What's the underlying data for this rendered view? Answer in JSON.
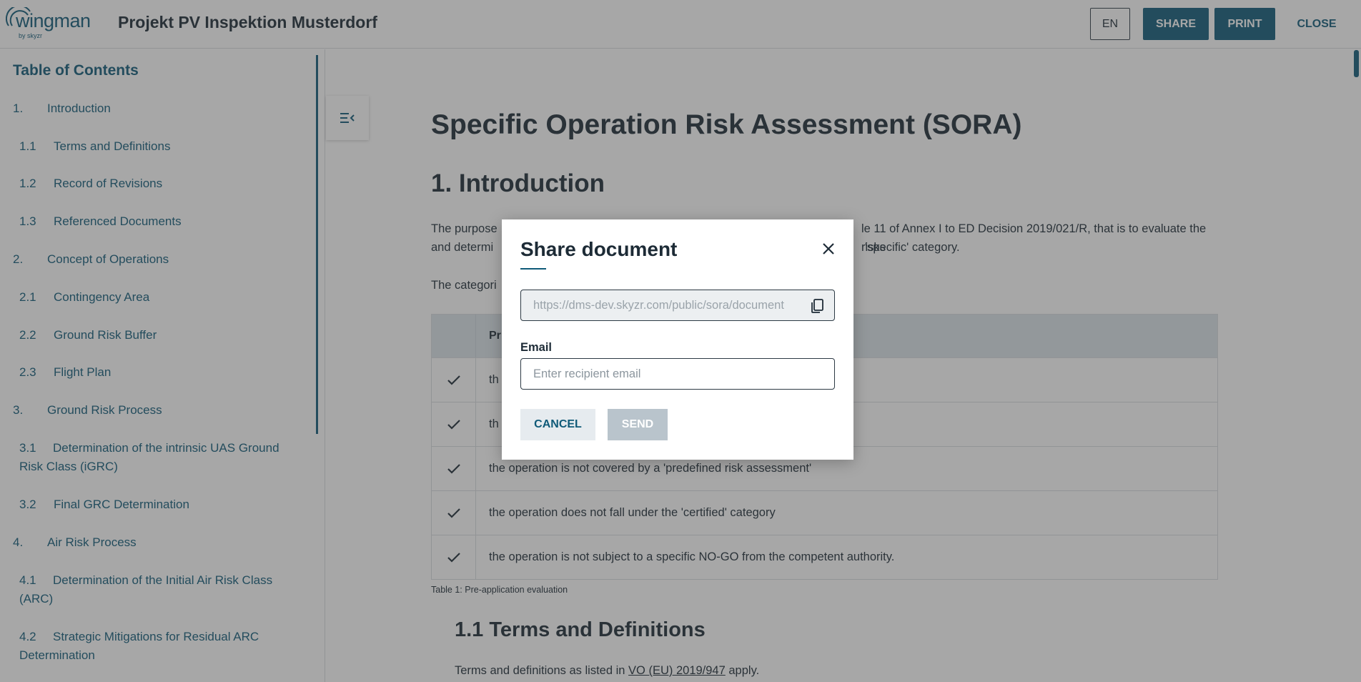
{
  "header": {
    "logo_text": "wingman",
    "logo_sub": "by skyzr",
    "project_title": "Projekt PV Inspektion Musterdorf",
    "lang_button": "EN",
    "share_button": "SHARE",
    "print_button": "PRINT",
    "close_button": "CLOSE",
    "accent_color": "#0f5a78"
  },
  "sidebar": {
    "title": "Table of Contents",
    "items": [
      {
        "num": "1.",
        "label": "Introduction"
      },
      {
        "num": "1.1",
        "label": "Terms and Definitions"
      },
      {
        "num": "1.2",
        "label": "Record of Revisions"
      },
      {
        "num": "1.3",
        "label": "Referenced Documents"
      },
      {
        "num": "2.",
        "label": "Concept of Operations"
      },
      {
        "num": "2.1",
        "label": "Contingency Area"
      },
      {
        "num": "2.2",
        "label": "Ground Risk Buffer"
      },
      {
        "num": "2.3",
        "label": "Flight Plan"
      },
      {
        "num": "3.",
        "label": "Ground Risk Process"
      },
      {
        "num": "3.1",
        "label": "Determination of the intrinsic UAS Ground Risk Class (iGRC)"
      },
      {
        "num": "3.2",
        "label": "Final GRC Determination"
      },
      {
        "num": "4.",
        "label": "Air Risk Process"
      },
      {
        "num": "4.1",
        "label": "Determination of the Initial Air Risk Class (ARC)"
      },
      {
        "num": "4.2",
        "label": "Strategic Mitigations for Residual ARC Determination"
      }
    ]
  },
  "document": {
    "title": "Specific Operation Risk Assessment (SORA)",
    "section1_heading": "1. Introduction",
    "intro_line1_left": "The purpose",
    "intro_line1_right": "le 11 of Annex I to ED Decision 2019/021/R, that is to evaluate the risks",
    "intro_line2_left": "and determi",
    "intro_line2_right": "'specific' category.",
    "categorization_left": "The categori",
    "table": {
      "header": "Pr",
      "rows": [
        "th",
        "th",
        "the operation is not covered by a 'predefined risk assessment'",
        "the operation does not fall under the 'certified' category",
        "the operation is not subject to a specific NO-GO from the competent authority."
      ],
      "check_icon": "check-icon"
    },
    "caption": "Table 1: Pre-application evaluation",
    "section11_heading": "1.1 Terms and Definitions",
    "terms_prefix": "Terms and definitions as listed in ",
    "terms_link": "VO (EU) 2019/947",
    "terms_suffix": " apply."
  },
  "modal": {
    "title": "Share document",
    "link_value": "https://dms-dev.skyzr.com/public/sora/document",
    "email_label": "Email",
    "email_placeholder": "Enter recipient email",
    "cancel_button": "CANCEL",
    "send_button": "SEND"
  }
}
